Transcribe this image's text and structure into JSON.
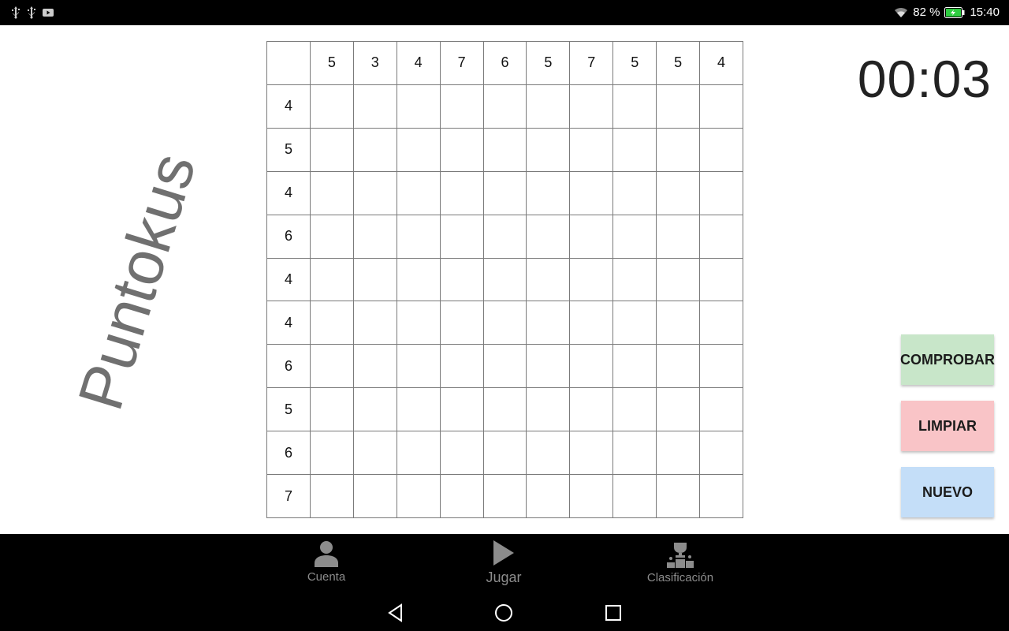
{
  "status_bar": {
    "battery_percent": "82 %",
    "time": "15:40",
    "icons": [
      "usb-icon",
      "usb-icon",
      "youtube-icon",
      "wifi-icon",
      "battery-charging-icon"
    ]
  },
  "app": {
    "logo_text": "Puntokus",
    "timer": "00:03"
  },
  "grid": {
    "column_clues": [
      "5",
      "3",
      "4",
      "7",
      "6",
      "5",
      "7",
      "5",
      "5",
      "4"
    ],
    "row_clues": [
      "4",
      "5",
      "4",
      "6",
      "4",
      "4",
      "6",
      "5",
      "6",
      "7"
    ]
  },
  "actions": {
    "check_label": "COMPROBAR",
    "clear_label": "LIMPIAR",
    "new_label": "NUEVO",
    "colors": {
      "check": "#c8e6c9",
      "clear": "#f9c4c7",
      "new": "#c4def8"
    }
  },
  "bottom_nav": {
    "items": [
      {
        "label": "Cuenta",
        "icon": "account-icon"
      },
      {
        "label": "Jugar",
        "icon": "play-icon"
      },
      {
        "label": "Clasificación",
        "icon": "leaderboard-icon"
      }
    ]
  },
  "system_nav": {
    "icons": [
      "back-icon",
      "home-icon",
      "recents-icon"
    ]
  }
}
